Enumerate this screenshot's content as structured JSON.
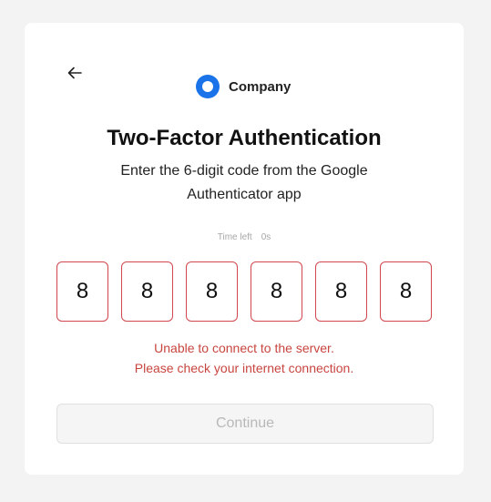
{
  "brand": {
    "name": "Company",
    "logo_icon": "ring-logo-icon",
    "logo_color": "#1a73e8"
  },
  "back": {
    "icon": "arrow-left-icon"
  },
  "heading": {
    "title": "Two-Factor Authentication",
    "subtitle": "Enter the 6-digit code from the Google Authenticator app"
  },
  "timer": {
    "label": "Time left",
    "value": "0s"
  },
  "code": {
    "digits": [
      "8",
      "8",
      "8",
      "8",
      "8",
      "8"
    ],
    "state": "error",
    "border_color": "#d0474f"
  },
  "error": {
    "line1": "Unable to connect to the server.",
    "line2": "Please check your internet connection.",
    "color": "#c8453f"
  },
  "actions": {
    "continue_label": "Continue",
    "continue_disabled": true
  }
}
